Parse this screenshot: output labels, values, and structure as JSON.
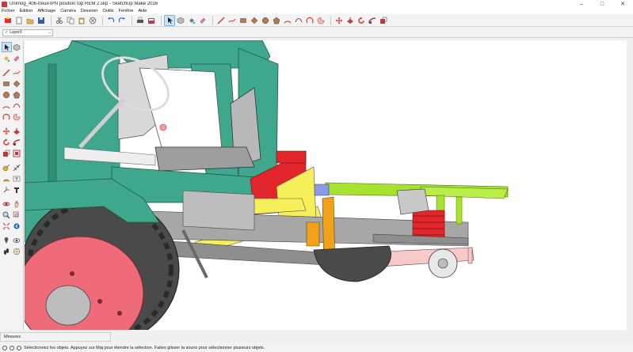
{
  "window": {
    "title": "Unimog_406-treuil-IPN position top REM 2.skp - SketchUp Make 2016",
    "minimize": "–",
    "maximize": "□",
    "close": "✕"
  },
  "menu": {
    "items": [
      "Fichier",
      "Édition",
      "Affichage",
      "Caméra",
      "Dessiner",
      "Outils",
      "Fenêtre",
      "Aide"
    ]
  },
  "layers": {
    "current": "Layer0",
    "arrow": "⌄"
  },
  "measures": {
    "label": "Mesures"
  },
  "status": {
    "message": "Sélectionnez les objets. Appuyez sur Maj pour étendre la sélection. Faites glisser la souris pour sélectionner plusieurs objets."
  },
  "colors": {
    "cab_green": "#3fa88c",
    "chassis_yellow": "#f5ef5a",
    "wheel_red": "#f06b7a",
    "tire_dark": "#4a4a4a",
    "frame_grey": "#9a9a9a",
    "lime": "#a6e22e",
    "spring_red": "#e2262b",
    "orange_post": "#f0a21a",
    "pink_beam": "#f7c9c9",
    "seat_grey": "#b8b8b8"
  }
}
